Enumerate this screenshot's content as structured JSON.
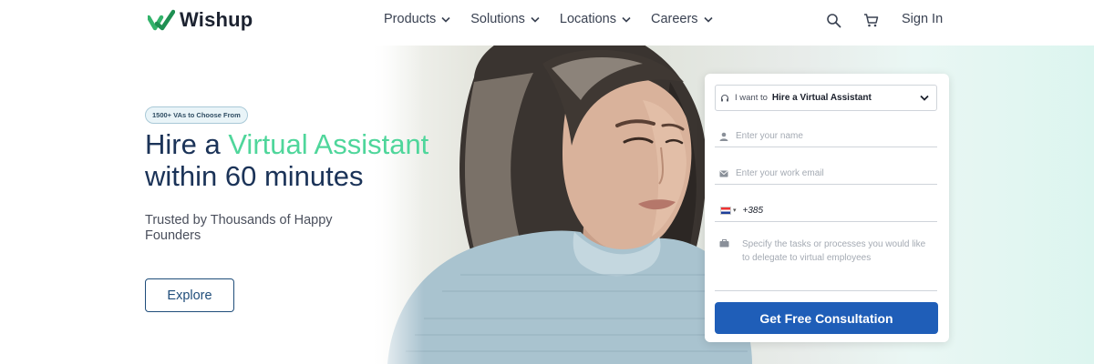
{
  "brand": {
    "name": "Wishup",
    "color": "#4fd69b"
  },
  "nav": {
    "items": [
      {
        "label": "Products",
        "icon": "chevron-down-icon"
      },
      {
        "label": "Solutions",
        "icon": "chevron-down-icon"
      },
      {
        "label": "Locations",
        "icon": "chevron-down-icon"
      },
      {
        "label": "Careers",
        "icon": "chevron-down-icon"
      }
    ],
    "search_icon": "search-icon",
    "cart_icon": "cart-icon",
    "signin_label": "Sign In"
  },
  "hero": {
    "badge": "1500+ VAs to Choose From",
    "headline_prefix": "Hire a ",
    "headline_accent": "Virtual Assistant",
    "headline_suffix": "within 60 minutes",
    "subtext": "Trusted by Thousands of Happy Founders",
    "explore_label": "Explore",
    "accent_color": "#4fd69b",
    "heading_color": "#1b3358"
  },
  "form": {
    "want_label": "I want to",
    "want_value": "Hire a Virtual Assistant",
    "name_placeholder": "Enter your name",
    "email_placeholder": "Enter your work email",
    "phone_code": "+385",
    "task_placeholder": "Specify the tasks or processes you would like to delegate to virtual employees",
    "cta_label": "Get Free Consultation",
    "cta_color": "#1f5eb8"
  }
}
